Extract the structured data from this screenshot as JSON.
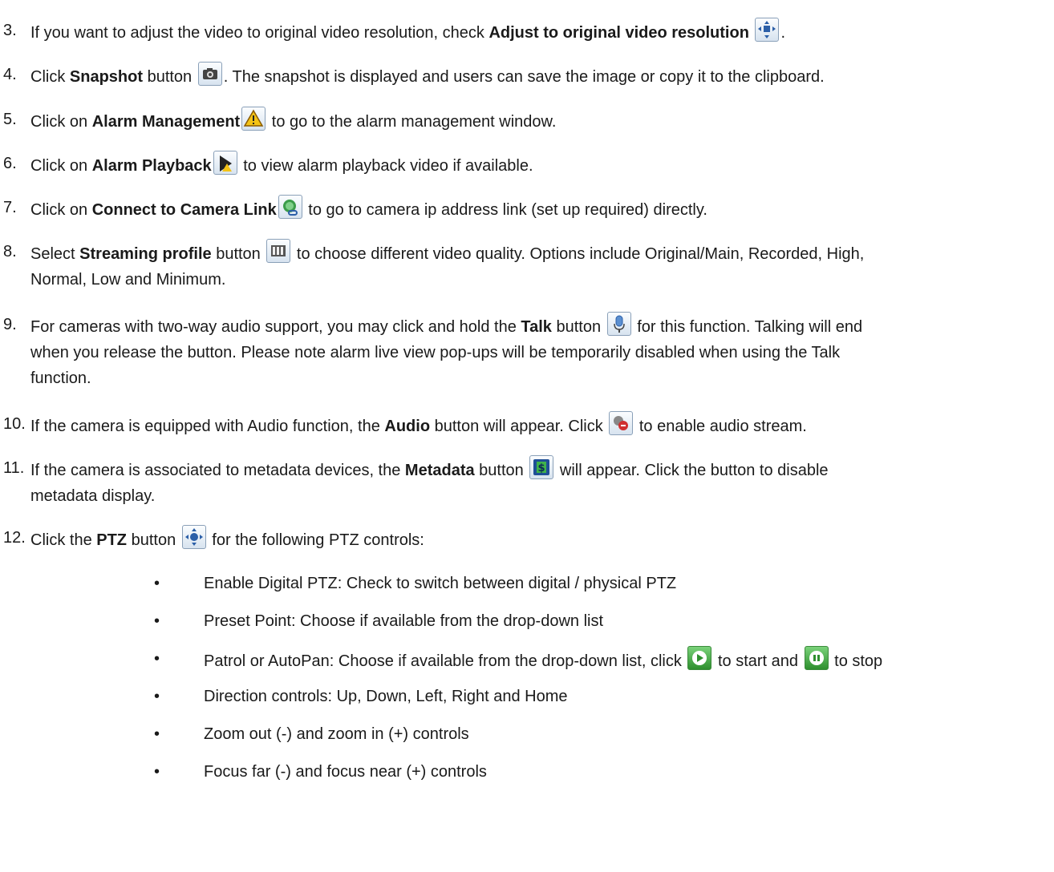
{
  "items": [
    {
      "num": "3.",
      "pre": "If you want to adjust the video to original video resolution, check ",
      "bold": "Adjust to original video resolution",
      "icon": "adjust-resolution-icon",
      "post": "."
    },
    {
      "num": "4.",
      "pre": "Click ",
      "bold": "Snapshot",
      "mid": " button ",
      "icon": "camera-icon",
      "post": ". The snapshot is displayed and users can save the image or copy it to the clipboard."
    },
    {
      "num": "5.",
      "pre": "Click on ",
      "bold": "Alarm Management",
      "icon": "warning-icon",
      "post": " to go to the alarm management window."
    },
    {
      "num": "6.",
      "pre": "Click on ",
      "bold": "Alarm Playback",
      "icon": "alarm-playback-icon",
      "post": " to view alarm playback video if available."
    },
    {
      "num": "7.",
      "pre": "Click on ",
      "bold": "Connect to Camera Link",
      "icon": "camera-link-icon",
      "post": " to go to camera ip address link (set up required) directly."
    },
    {
      "num": "8.",
      "pre": "Select ",
      "bold": "Streaming profile",
      "mid": " button ",
      "icon": "film-icon",
      "post": " to choose different video quality.  Options include Original/Main, Recorded, High,",
      "line2": "Normal, Low and Minimum."
    },
    {
      "num": "9.",
      "pre": "For cameras with two-way audio support, you may click and hold the ",
      "bold": "Talk",
      "mid": " button ",
      "icon": "microphone-icon",
      "post": " for this function.  Talking will end",
      "line2": "when you release the button.  Please note alarm live view pop-ups will be temporarily disabled when using the Talk",
      "line3": "function."
    },
    {
      "num": "10.",
      "pre": "If the camera is equipped with Audio function, the ",
      "bold": "Audio",
      "mid": " button will appear. Click ",
      "icon": "audio-icon",
      "post": " to enable audio stream."
    },
    {
      "num": "11.",
      "pre": "If the camera is associated to metadata devices, the ",
      "bold": "Metadata",
      "mid": " button ",
      "icon": "metadata-icon",
      "post": " will appear. Click the button to disable",
      "line2": "metadata display."
    },
    {
      "num": "12.",
      "pre": "Click the ",
      "bold": "PTZ",
      "mid": " button ",
      "icon": "ptz-icon",
      "post": " for the following PTZ controls:"
    }
  ],
  "bullets": [
    {
      "sym": "•",
      "text": "Enable Digital PTZ: Check to switch between digital / physical PTZ"
    },
    {
      "sym": "•",
      "text": "Preset Point: Choose if available from the drop-down list"
    },
    {
      "sym": "•",
      "pre": "Patrol or AutoPan: Choose if available from the drop-down list, click ",
      "icon1": "play-icon",
      "mid": " to start and ",
      "icon2": "stop-icon",
      "post": " to stop"
    },
    {
      "sym": "•",
      "text": "Direction controls: Up, Down, Left, Right and Home"
    },
    {
      "sym": "•",
      "text": "Zoom out (-) and zoom in (+) controls"
    },
    {
      "sym": "•",
      "text": "Focus far (-) and focus near (+) controls"
    }
  ]
}
